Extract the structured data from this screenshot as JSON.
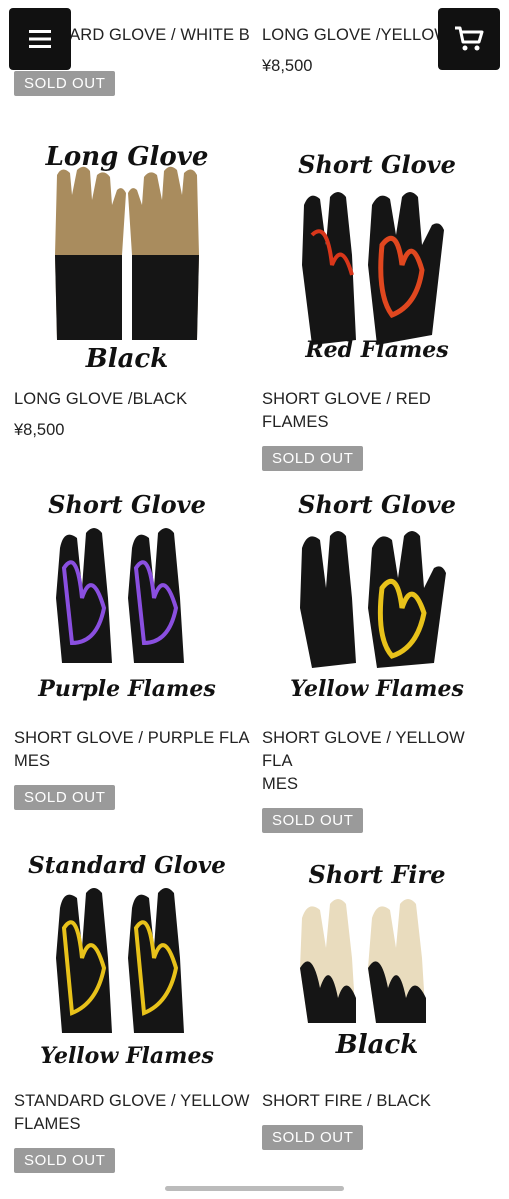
{
  "header": {
    "menu_icon": "hamburger-icon",
    "cart_icon": "cart-icon"
  },
  "products": [
    {
      "title": "STANDARD GLOVE / WHITE B",
      "status": "SOLD OUT"
    },
    {
      "title": "LONG GLOVE /YELLOW",
      "price": "¥8,500"
    },
    {
      "title": "LONG GLOVE /BLACK",
      "price": "¥8,500",
      "img_top": "Long Glove",
      "img_bottom": "Black"
    },
    {
      "title": "SHORT GLOVE / RED FLAMES",
      "status": "SOLD OUT",
      "img_top": "Short Glove",
      "img_bottom": "Red Flames"
    },
    {
      "title": "SHORT GLOVE / PURPLE FLA MES",
      "status": "SOLD OUT",
      "img_top": "Short Glove",
      "img_bottom": "Purple Flames"
    },
    {
      "title": "SHORT GLOVE / YELLOW FLA MES",
      "status": "SOLD OUT",
      "img_top": "Short Glove",
      "img_bottom": "Yellow Flames"
    },
    {
      "title": "STANDARD GLOVE / YELLOW FLAMES",
      "status": "SOLD OUT",
      "img_top": "Standard Glove",
      "img_bottom": "Yellow Flames"
    },
    {
      "title": "SHORT FIRE / BLACK",
      "status": "SOLD OUT",
      "img_top": "Short Fire",
      "img_bottom": "Black"
    }
  ],
  "colors": {
    "sold_badge": "#9a9a9a",
    "header_button": "#111111"
  }
}
